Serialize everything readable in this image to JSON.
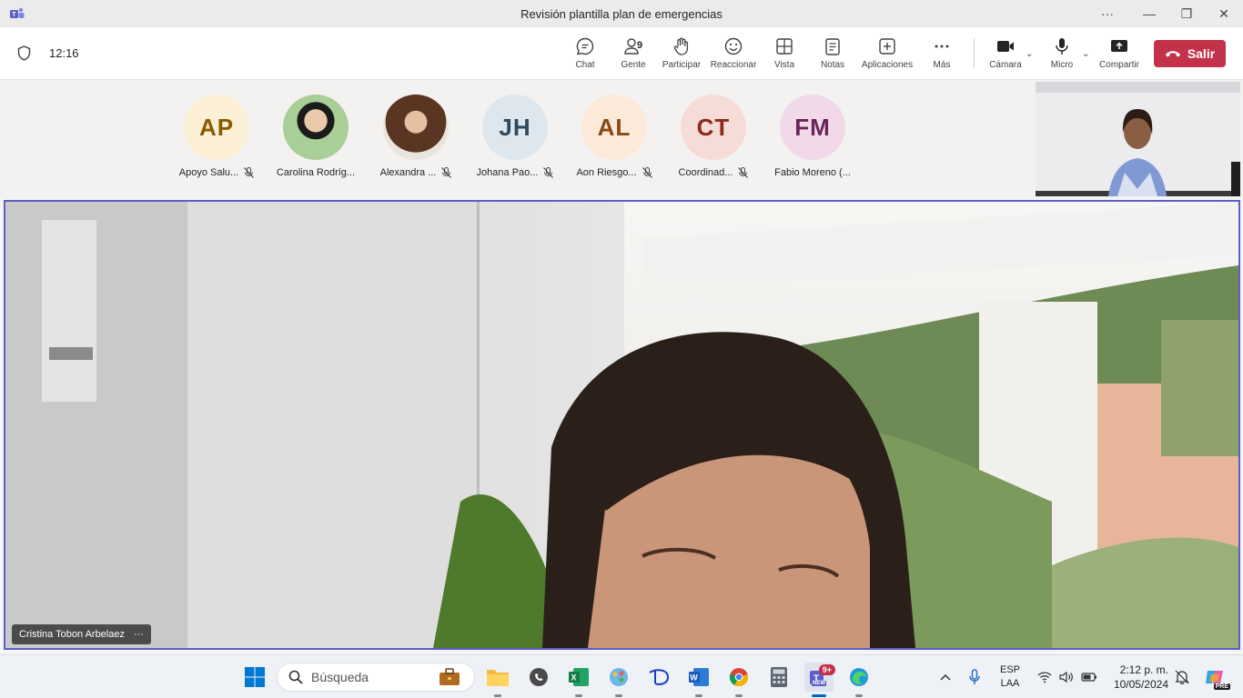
{
  "window": {
    "title": "Revisión plantilla plan de emergencias",
    "more_label": "···",
    "minimize_label": "—",
    "maximize_label": "❐",
    "close_label": "✕"
  },
  "toolbar": {
    "timer": "12:16",
    "people_count": "9",
    "buttons": {
      "chat": "Chat",
      "people": "Gente",
      "raise": "Participar",
      "react": "Reaccionar",
      "view": "Vista",
      "notes": "Notas",
      "apps": "Aplicaciones",
      "more": "Más",
      "camera": "Cámara",
      "mic": "Micro",
      "share": "Compartir"
    },
    "leave_label": "Salir",
    "leave_color": "#c4314b"
  },
  "participants": [
    {
      "initials": "AP",
      "name": "Apoyo Salu...",
      "bg": "#fbefd5",
      "fg": "#8a5a00",
      "muted": true
    },
    {
      "initials": "",
      "name": "Carolina Rodríg...",
      "bg": "#cde3c9",
      "fg": "#333",
      "muted": false
    },
    {
      "initials": "",
      "name": "Alexandra ...",
      "bg": "#5a3a2c",
      "fg": "#fff",
      "muted": true
    },
    {
      "initials": "JH",
      "name": "Johana Pao...",
      "bg": "#dfe7ee",
      "fg": "#2f4a5e",
      "muted": true
    },
    {
      "initials": "AL",
      "name": "Aon Riesgo...",
      "bg": "#fbe9d9",
      "fg": "#8a4a14",
      "muted": true
    },
    {
      "initials": "CT",
      "name": "Coordinad...",
      "bg": "#f6dcd6",
      "fg": "#8c2a1c",
      "muted": true
    },
    {
      "initials": "FM",
      "name": "Fabio Moreno (...",
      "bg": "#f1d9ea",
      "fg": "#6b2456",
      "muted": false
    }
  ],
  "main_video": {
    "speaker_name": "Cristina Tobon Arbelaez",
    "more_label": "···",
    "border_color": "#5b5fc7"
  },
  "taskbar": {
    "search_placeholder": "Búsqueda",
    "teams_badge": "9+",
    "teams_new": "NEW",
    "language_line1": "ESP",
    "language_line2": "LAA",
    "time": "2:12 p. m.",
    "date": "10/05/2024",
    "copilot_tag": "PRE"
  }
}
